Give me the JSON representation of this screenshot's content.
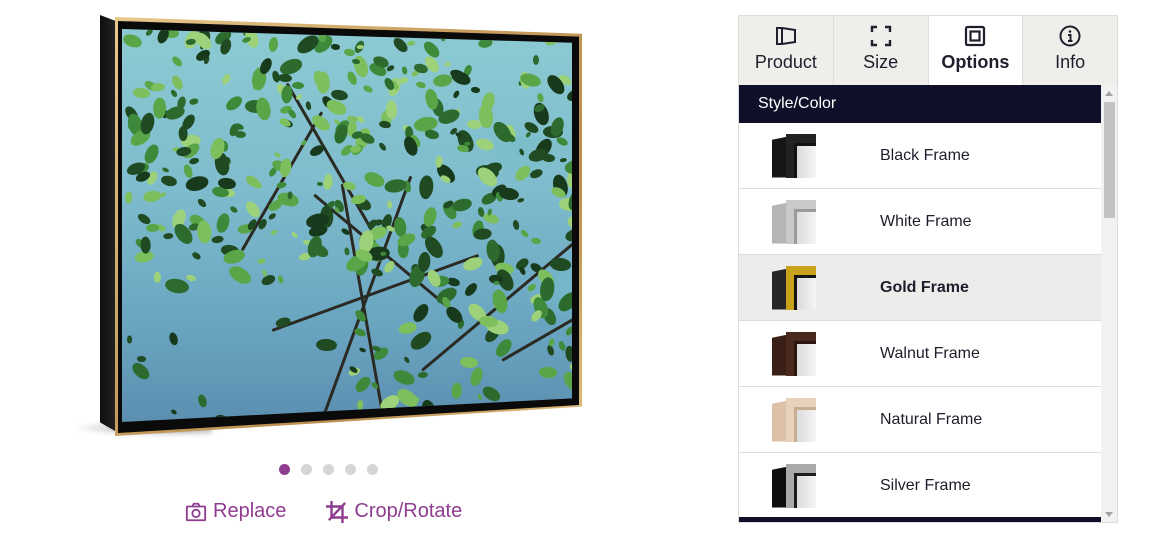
{
  "preview": {
    "carousel": {
      "count": 5,
      "active_index": 0
    },
    "actions": [
      {
        "label": "Replace",
        "icon": "camera-icon"
      },
      {
        "label": "Crop/Rotate",
        "icon": "crop-icon"
      }
    ],
    "accent_color": "#8e3c8f"
  },
  "panel": {
    "tabs": [
      {
        "label": "Product",
        "icon": "product-icon",
        "active": false
      },
      {
        "label": "Size",
        "icon": "size-icon",
        "active": false
      },
      {
        "label": "Options",
        "icon": "options-icon",
        "active": true
      },
      {
        "label": "Info",
        "icon": "info-icon",
        "active": false
      }
    ],
    "section_title": "Style/Color",
    "header_color": "#100f2a",
    "items": [
      {
        "label": "Black Frame",
        "selected": false,
        "colors": {
          "side": "#161616",
          "front": "#222222",
          "lip": "#111111"
        }
      },
      {
        "label": "White Frame",
        "selected": false,
        "colors": {
          "side": "#b5b5b5",
          "front": "#c9c9c9",
          "lip": "#9a9a9a"
        }
      },
      {
        "label": "Gold Frame",
        "selected": true,
        "colors": {
          "side": "#262626",
          "front": "#c9a21c",
          "lip": "#141414"
        }
      },
      {
        "label": "Walnut Frame",
        "selected": false,
        "colors": {
          "side": "#3a1f16",
          "front": "#4a2a1f",
          "lip": "#2c1610"
        }
      },
      {
        "label": "Natural Frame",
        "selected": false,
        "colors": {
          "side": "#dcc1a6",
          "front": "#e8d2bb",
          "lip": "#c9ad90"
        }
      },
      {
        "label": "Silver Frame",
        "selected": false,
        "colors": {
          "side": "#0e0e0e",
          "front": "#a9a9a9",
          "lip": "#1c1c1c"
        }
      }
    ]
  }
}
